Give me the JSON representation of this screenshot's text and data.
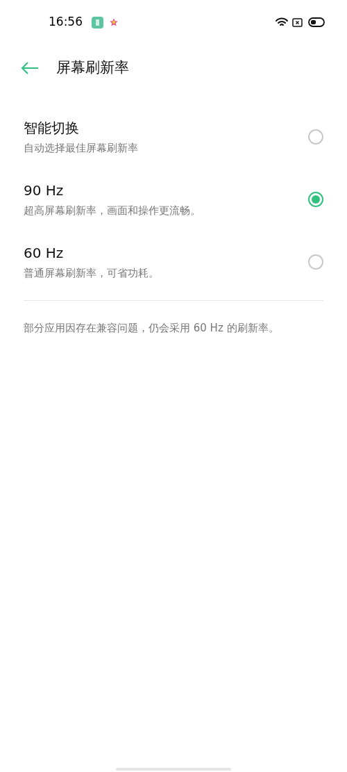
{
  "status_bar": {
    "time": "16:56"
  },
  "header": {
    "title": "屏幕刷新率"
  },
  "options": [
    {
      "title": "智能切换",
      "subtitle": "自动选择最佳屏幕刷新率",
      "selected": false
    },
    {
      "title": "90 Hz",
      "subtitle": "超高屏幕刷新率，画面和操作更流畅。",
      "selected": true
    },
    {
      "title": "60 Hz",
      "subtitle": "普通屏幕刷新率，可省功耗。",
      "selected": false
    }
  ],
  "note": "部分应用因存在兼容问题，仍会采用 60 Hz 的刷新率。"
}
